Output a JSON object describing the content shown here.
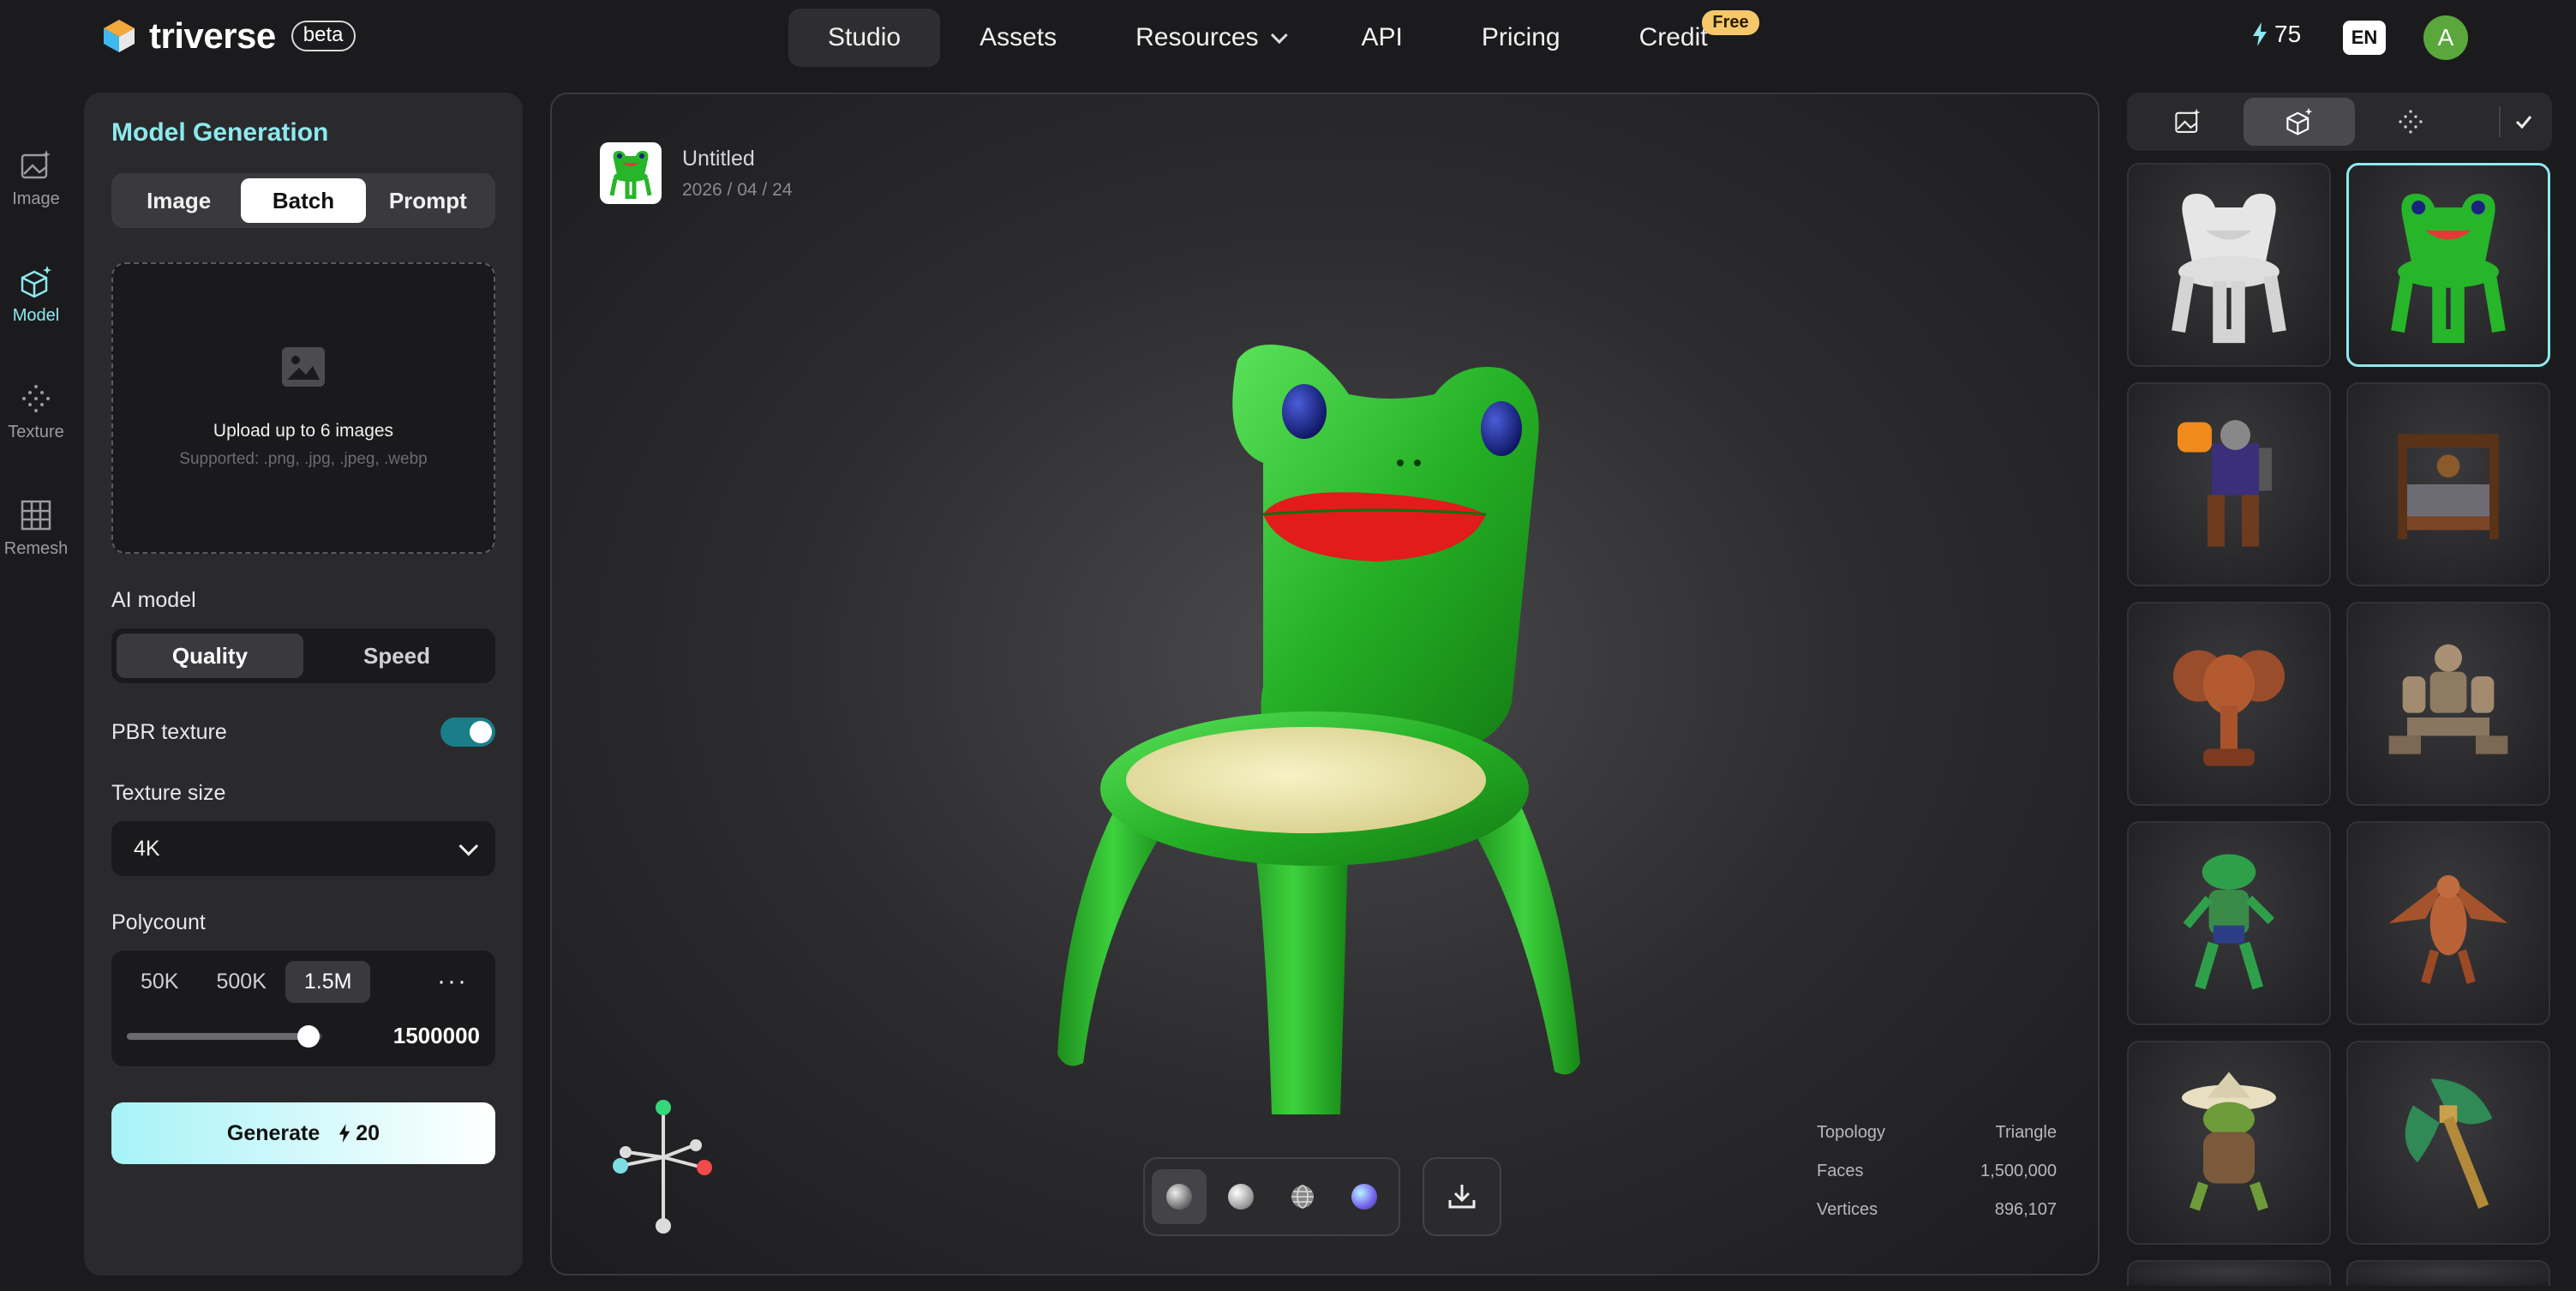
{
  "brand": {
    "name": "triverse",
    "badge": "beta"
  },
  "nav": {
    "items": [
      {
        "label": "Studio",
        "active": true
      },
      {
        "label": "Assets"
      },
      {
        "label": "Resources"
      },
      {
        "label": "API"
      },
      {
        "label": "Pricing"
      },
      {
        "label": "Credit",
        "badge": "Free"
      }
    ]
  },
  "account": {
    "credits": "75",
    "language": "EN",
    "avatar_initial": "A"
  },
  "rail": {
    "items": [
      {
        "label": "Image",
        "icon": "image-sparkle-icon"
      },
      {
        "label": "Model",
        "icon": "cube-sparkle-icon",
        "active": true
      },
      {
        "label": "Texture",
        "icon": "dots-pattern-icon"
      },
      {
        "label": "Remesh",
        "icon": "grid-mesh-icon"
      }
    ]
  },
  "panel": {
    "title": "Model Generation",
    "modes": [
      "Image",
      "Batch",
      "Prompt"
    ],
    "active_mode": "Batch",
    "upload": {
      "title": "Upload up to 6 images",
      "supported": "Supported: .png, .jpg, .jpeg, .webp"
    },
    "ai_model": {
      "label": "AI model",
      "options": [
        "Quality",
        "Speed"
      ],
      "active": "Quality"
    },
    "pbr": {
      "label": "PBR texture",
      "enabled": true
    },
    "texture_size": {
      "label": "Texture size",
      "value": "4K"
    },
    "polycount": {
      "label": "Polycount",
      "options": [
        "50K",
        "500K",
        "1.5M"
      ],
      "active": "1.5M",
      "more": "···",
      "value": "1500000",
      "slider_fraction": 0.93
    },
    "generate": {
      "label": "Generate",
      "cost": "20"
    }
  },
  "viewer": {
    "model_name": "Untitled",
    "date": "2026 / 04 / 24",
    "stats": [
      {
        "label": "Topology",
        "value": "Triangle"
      },
      {
        "label": "Faces",
        "value": "1,500,000"
      },
      {
        "label": "Vertices",
        "value": "896,107"
      }
    ],
    "render_modes": [
      "matcap-sphere-icon",
      "clay-sphere-icon",
      "wireframe-sphere-icon",
      "normal-sphere-icon"
    ],
    "active_render_mode": 0
  },
  "gallery": {
    "tabs": [
      "image-sparkle-icon",
      "cube-sparkle-icon",
      "dots-pattern-icon",
      "check-icon"
    ],
    "active_tab": 1,
    "items": [
      {
        "name": "white-frog-chair",
        "selected": false
      },
      {
        "name": "green-frog-chair",
        "selected": true
      },
      {
        "name": "pumpkin-knight",
        "selected": false
      },
      {
        "name": "ornate-bed",
        "selected": false
      },
      {
        "name": "elephant-statue",
        "selected": false
      },
      {
        "name": "sitting-robot",
        "selected": false
      },
      {
        "name": "frog-figure",
        "selected": false
      },
      {
        "name": "dragon",
        "selected": false
      },
      {
        "name": "frog-wizard",
        "selected": false
      },
      {
        "name": "jade-axe",
        "selected": false
      }
    ]
  },
  "colors": {
    "accent": "#8ee9ee",
    "toggle": "#197e88",
    "badge": "#f6c86a",
    "avatar": "#5aa73c"
  }
}
